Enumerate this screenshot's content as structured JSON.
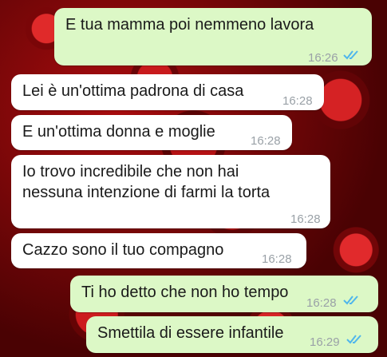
{
  "messages": [
    {
      "text": "E tua mamma poi nemmeno lavora",
      "time": "16:26",
      "direction": "out",
      "read": true
    },
    {
      "text": "Lei è un'ottima padrona di casa",
      "time": "16:28",
      "direction": "in"
    },
    {
      "text": "E un'ottima donna e moglie",
      "time": "16:28",
      "direction": "in"
    },
    {
      "text_line1": "Io trovo incredibile che non hai",
      "text_line2": "nessuna intenzione di farmi la torta",
      "time": "16:28",
      "direction": "in"
    },
    {
      "text": "Cazzo sono il tuo compagno",
      "time": "16:28",
      "direction": "in"
    },
    {
      "text": "Ti ho detto che non ho tempo",
      "time": "16:28",
      "direction": "out",
      "read": true
    },
    {
      "text": "Smettila di essere infantile",
      "time": "16:29",
      "direction": "out",
      "read": true
    }
  ],
  "colors": {
    "outgoing_bubble": "#dcf8c6",
    "incoming_bubble": "#ffffff",
    "read_ticks": "#4fb6ec",
    "wallpaper": "#8a0a0c"
  },
  "icons": {
    "read_receipt": "double-check-icon"
  }
}
